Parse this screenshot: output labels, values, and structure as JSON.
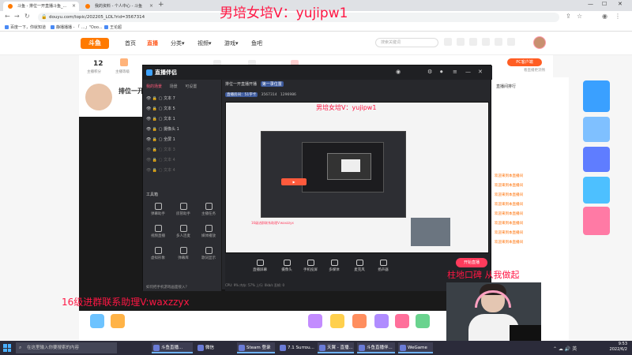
{
  "browser": {
    "tabs": [
      {
        "title": "斗鱼 - 排位一开直播斗鱼_...",
        "close": "×"
      },
      {
        "title": "我的资料 - 个人中心 - 斗鱼",
        "close": "×"
      }
    ],
    "new_tab": "+",
    "url": "douyu.com/topic/202205_LOL?rid=3567314",
    "bookmarks": [
      "百度一下，你就知道",
      "静播播播 - 「 …」\"Ooo...",
      "王论超"
    ]
  },
  "douyu": {
    "logo": "斗鱼",
    "nav": [
      "首页",
      "直播",
      "分类▾",
      "视频▾",
      "游戏▾",
      "鱼吧"
    ],
    "search_placeholder": "搜索关键词",
    "followers": "12",
    "stat_labels": [
      "主播积分",
      "主播等级"
    ],
    "pc_button": "PC客户端",
    "pc_label": "看直播更流畅",
    "room_title": "排位一开",
    "chat_header": "直播间排行",
    "chat_messages": [
      "欢迎来到本直播间",
      "欢迎来到本直播间",
      "欢迎来到本直播间",
      "欢迎来到本直播间",
      "欢迎来到本直播间",
      "欢迎来到本直播间",
      "欢迎来到本直播间",
      "欢迎来到本直播间"
    ]
  },
  "obs": {
    "logo": "直播伴侣",
    "scene_tabs": [
      "我的场景",
      "场景",
      "可设置"
    ],
    "sources": [
      "文本 7",
      "文本 5",
      "文本 1",
      "摄像头 1",
      "全屏 1",
      "文本 3",
      "文本 4",
      "文本 4"
    ],
    "tools_title": "工具箱",
    "tools": [
      "弹幕助手",
      "房管助手",
      "主播任务",
      "视频直播",
      "多人连麦",
      "媒体播放",
      "虚拟形象",
      "弹幕库",
      "歌词显示"
    ],
    "tip": "如何把手机游戏画面接入？",
    "top_line": "排位一开直播开播",
    "top_btn": "第一录位置",
    "room_badge": "直播房间：51字卡",
    "room_id": "3567314",
    "views": "1296986",
    "preview_overlay": "男培女培V：yujipw1",
    "preview_caption": "16级进群联系助理V:waxzzyx",
    "bottom_tools": [
      "直播屏幕",
      "摄像头",
      "手机投屏",
      "多媒体",
      "麦克风",
      "扬声器"
    ],
    "start_live": "开始直播",
    "status": "CPU: 9%   内存: 57%   上行: 0kb/s   丢帧: 0"
  },
  "overlays": {
    "top": "男培女培V：yujipw1",
    "mid": "男培女培V：yujipw1",
    "left": "16级进群联系助理V:waxzzyx",
    "right": "柱地口碑 从我做起"
  },
  "taskbar": {
    "search": "在这里输入你要搜索的内容",
    "items": [
      "斗鱼直播...",
      "微信",
      "Steam 登录",
      "7.1 Surrou...",
      "天翼 - 直播...",
      "斗鱼直播伴...",
      "WeGame"
    ],
    "time": "9:53",
    "date": "2022/6/2"
  },
  "colors": {
    "accent": "#ff5d23",
    "overlay_red": "#ff1744",
    "obs_bg": "#27282c",
    "start_live": "#ff3b5c"
  }
}
